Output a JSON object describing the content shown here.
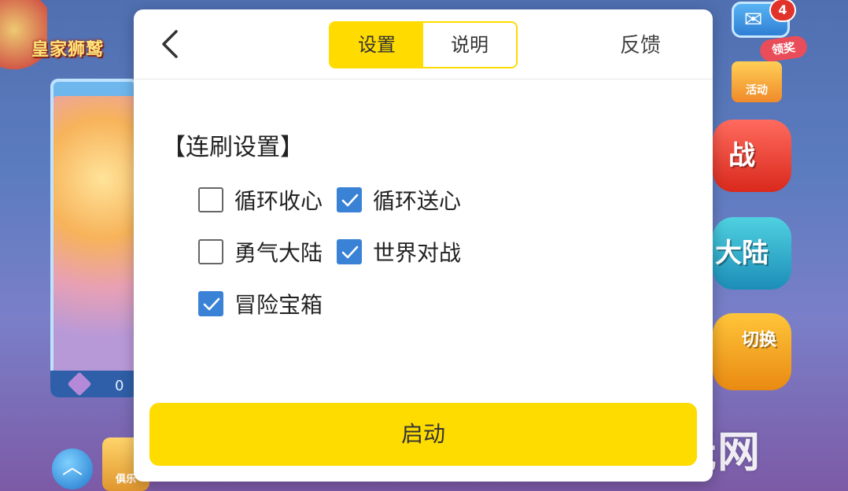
{
  "background": {
    "banner_title": "皇家狮鹫",
    "card_count": "0",
    "mail_badge_count": "4",
    "reward_label": "领奖",
    "activity_label": "活动",
    "side_button_battle": "战",
    "side_button_continent": "大陆",
    "side_button_switch": "切换",
    "club_label": "俱乐",
    "watermark": "玩网"
  },
  "dialog": {
    "tabs": [
      {
        "label": "设置",
        "active": true
      },
      {
        "label": "说明",
        "active": false
      }
    ],
    "feedback_label": "反馈",
    "section_title": "【连刷设置】",
    "options": [
      {
        "label": "循环收心",
        "checked": false
      },
      {
        "label": "循环送心",
        "checked": true
      },
      {
        "label": "勇气大陆",
        "checked": false
      },
      {
        "label": "世界对战",
        "checked": true
      },
      {
        "label": "冒险宝箱",
        "checked": true
      }
    ],
    "start_label": "启动"
  },
  "colors": {
    "accent_yellow": "#ffdc00",
    "checkbox_blue": "#3a82d6"
  },
  "icons": {
    "back": "chevron-left-icon",
    "check": "checkmark-icon",
    "mail": "mail-icon"
  }
}
